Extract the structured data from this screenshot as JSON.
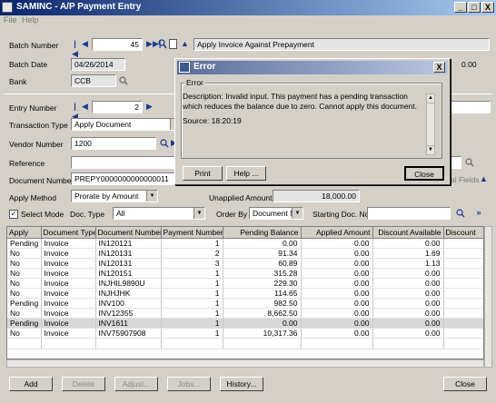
{
  "window": {
    "title": "SAMINC - A/P Payment Entry",
    "min": "_",
    "max": "□",
    "close": "X"
  },
  "menu": {
    "file": "File",
    "help": "Help"
  },
  "batch": {
    "label": "Batch Number",
    "number": "45",
    "description": "Apply Invoice Against Prepayment",
    "date_label": "Batch Date",
    "date": "04/26/2014",
    "bank_label": "Bank",
    "bank": "CCB",
    "amount_right": "0.00"
  },
  "entry": {
    "label": "Entry Number",
    "number": "2",
    "transaction_type_label": "Transaction Type",
    "transaction_type": "Apply Document",
    "vendor_label": "Vendor Number",
    "vendor": "1200",
    "reference_label": "Reference",
    "reference": "",
    "document_label": "Document Number",
    "document": "PREPY0000000000000011",
    "optional_fields": "al Fields",
    "apply_method_label": "Apply Method",
    "apply_method": "Prorate by Amount",
    "unapplied_label": "Unapplied Amount",
    "unapplied": "18,000.00"
  },
  "filter": {
    "select_mode": "Select Mode",
    "doc_type_label": "Doc. Type",
    "doc_type": "All",
    "order_by_label": "Order By",
    "order_by": "Document Number",
    "starting_label": "Starting Doc. No.",
    "starting": ""
  },
  "grid": {
    "columns": [
      "Apply",
      "Document Type",
      "Document Number",
      "Payment Number",
      "Pending Balance",
      "Applied Amount",
      "Discount Available",
      "Discount"
    ],
    "rows": [
      [
        "Pending",
        "Invoice",
        "IN120121",
        "1",
        "0.00",
        "0.00",
        "0.00",
        ""
      ],
      [
        "No",
        "Invoice",
        "IN120131",
        "2",
        "91.34",
        "0.00",
        "1.69",
        ""
      ],
      [
        "No",
        "Invoice",
        "IN120131",
        "3",
        "60.89",
        "0.00",
        "1.13",
        ""
      ],
      [
        "No",
        "Invoice",
        "IN120151",
        "1",
        "315.28",
        "0.00",
        "0.00",
        ""
      ],
      [
        "No",
        "Invoice",
        "INJHIL9890U",
        "1",
        "229.30",
        "0.00",
        "0.00",
        ""
      ],
      [
        "No",
        "Invoice",
        "INJHJHK",
        "1",
        "114.65",
        "0.00",
        "0.00",
        ""
      ],
      [
        "Pending",
        "Invoice",
        "INV100",
        "1",
        "982.50",
        "0.00",
        "0.00",
        ""
      ],
      [
        "No",
        "Invoice",
        "INV12355",
        "1",
        "8,662.50",
        "0.00",
        "0.00",
        ""
      ],
      [
        "Pending",
        "Invoice",
        "INV1611",
        "1",
        "0.00",
        "0.00",
        "0.00",
        ""
      ],
      [
        "No",
        "Invoice",
        "INV75907908",
        "1",
        "10,317.36",
        "0.00",
        "0.00",
        ""
      ],
      [
        "",
        "",
        "",
        "",
        "",
        "",
        "",
        ""
      ]
    ],
    "selected_row": 8
  },
  "buttons": {
    "add": "Add",
    "delete": "Delete",
    "adjust": "Adjust...",
    "jobs": "Jobs...",
    "history": "History...",
    "close": "Close"
  },
  "dialog": {
    "title": "Error",
    "group": "Error",
    "description": "Description: Invalid input. This payment has a pending transaction which reduces the balance due to zero. Cannot apply this document.",
    "source": "Source:  18:20:19",
    "print": "Print",
    "help": "Help ...",
    "close": "Close",
    "x": "X"
  }
}
